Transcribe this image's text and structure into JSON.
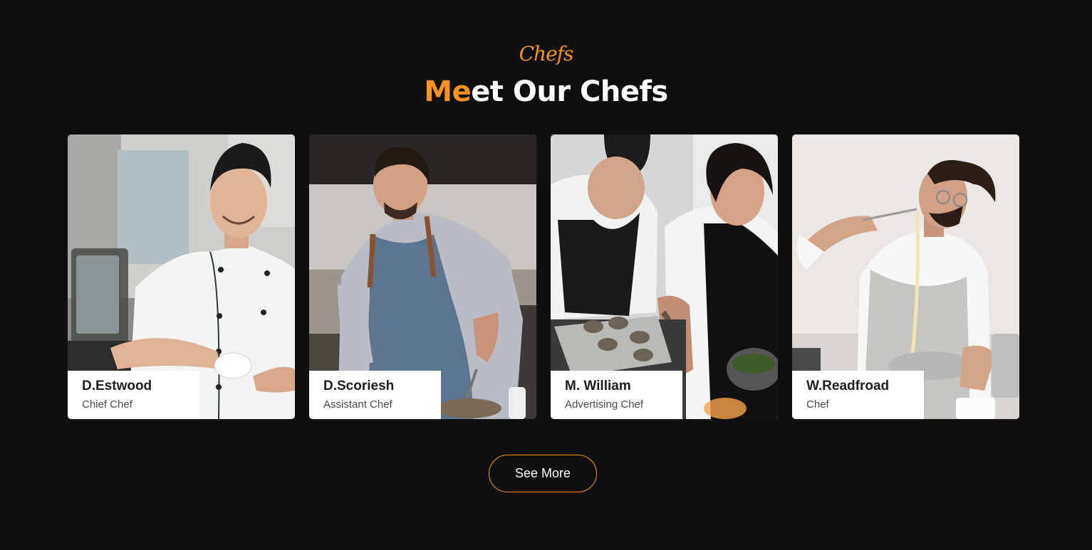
{
  "section": {
    "eyebrow": "Chefs",
    "title_accent": "Me",
    "title_rest": "et Our Chefs"
  },
  "chefs": [
    {
      "name": "D.Estwood",
      "role": "Chief Chef",
      "photo": "chef-smiling-holding-cup-photo"
    },
    {
      "name": "D.Scoriesh",
      "role": "Assistant Chef",
      "photo": "chef-in-apron-cooking-photo"
    },
    {
      "name": "M. William",
      "role": "Advertising Chef",
      "photo": "two-chefs-preparing-oysters-photo"
    },
    {
      "name": "W.Readfroad",
      "role": "Chef",
      "photo": "chef-whisking-bowl-photo"
    }
  ],
  "see_more_label": "See More",
  "colors": {
    "background": "#0f0f0f",
    "accent": "#f7931e",
    "text": "#ffffff",
    "plate": "#ffffff"
  }
}
